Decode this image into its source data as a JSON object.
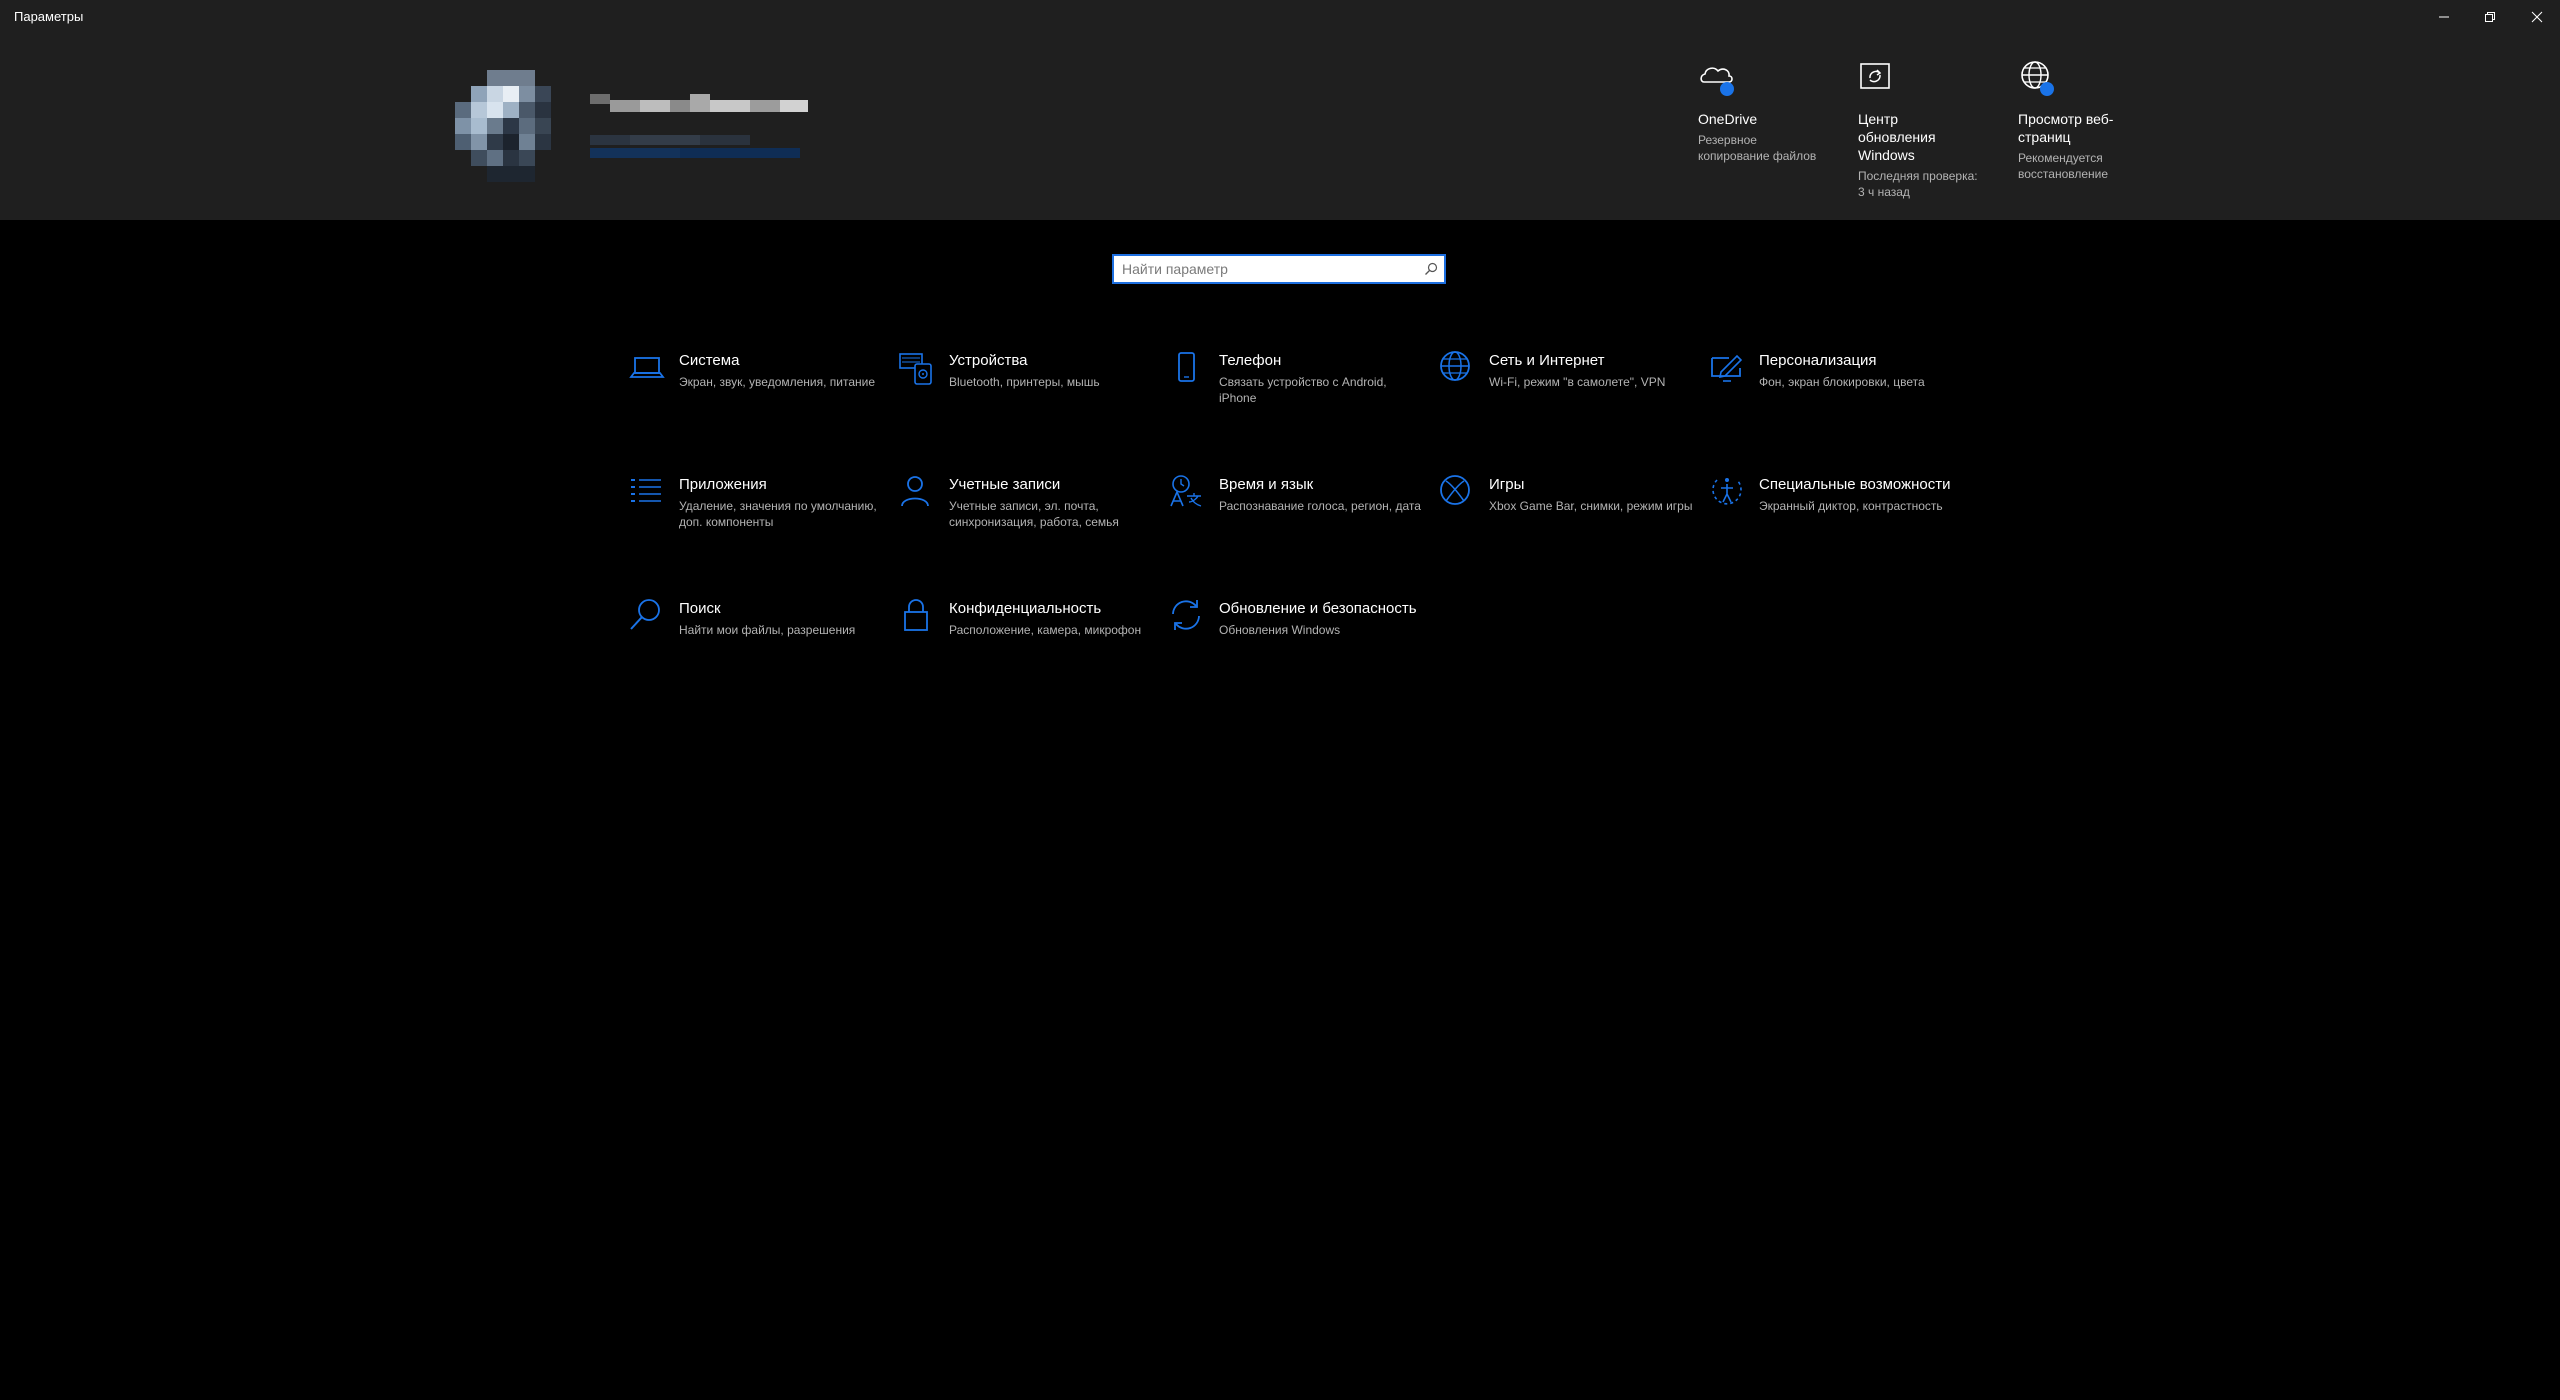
{
  "window": {
    "title": "Параметры"
  },
  "quick": [
    {
      "title": "OneDrive",
      "desc": "Резервное копирование файлов",
      "icon": "onedrive-icon"
    },
    {
      "title": "Центр обновления Windows",
      "desc": "Последняя проверка: 3 ч назад",
      "icon": "windows-update-icon"
    },
    {
      "title": "Просмотр веб-страниц",
      "desc": "Рекомендуется восстановление",
      "icon": "globe-icon"
    }
  ],
  "search": {
    "placeholder": "Найти параметр"
  },
  "categories": [
    {
      "title": "Система",
      "desc": "Экран, звук, уведомления, питание",
      "icon": "laptop-icon"
    },
    {
      "title": "Устройства",
      "desc": "Bluetooth, принтеры, мышь",
      "icon": "devices-icon"
    },
    {
      "title": "Телефон",
      "desc": "Связать устройство с Android, iPhone",
      "icon": "phone-icon"
    },
    {
      "title": "Сеть и Интернет",
      "desc": "Wi-Fi, режим \"в самолете\", VPN",
      "icon": "globe-icon"
    },
    {
      "title": "Персонализация",
      "desc": "Фон, экран блокировки, цвета",
      "icon": "personalization-icon"
    },
    {
      "title": "Приложения",
      "desc": "Удаление, значения по умолчанию, доп. компоненты",
      "icon": "apps-list-icon"
    },
    {
      "title": "Учетные записи",
      "desc": "Учетные записи, эл. почта, синхронизация, работа, семья",
      "icon": "person-icon"
    },
    {
      "title": "Время и язык",
      "desc": "Распознавание голоса, регион, дата",
      "icon": "time-language-icon"
    },
    {
      "title": "Игры",
      "desc": "Xbox Game Bar, снимки, режим игры",
      "icon": "xbox-icon"
    },
    {
      "title": "Специальные возможности",
      "desc": "Экранный диктор, контрастность",
      "icon": "accessibility-icon"
    },
    {
      "title": "Поиск",
      "desc": "Найти мои файлы, разрешения",
      "icon": "search-icon"
    },
    {
      "title": "Конфиденциальность",
      "desc": "Расположение, камера, микрофон",
      "icon": "lock-icon"
    },
    {
      "title": "Обновление и безопасность",
      "desc": "Обновления Windows",
      "icon": "update-icon"
    }
  ],
  "colors": {
    "accent": "#1a73e8",
    "background": "#000000",
    "header": "#1f1f1f"
  }
}
